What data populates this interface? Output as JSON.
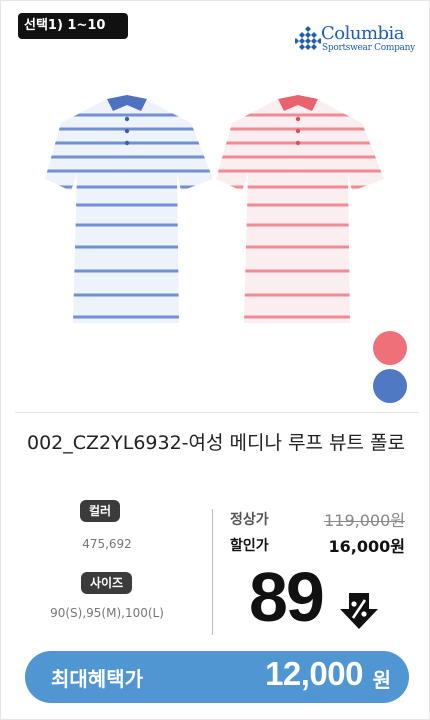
{
  "badge": {
    "select_label": "선택1) 1~10"
  },
  "brand": {
    "name": "Columbia",
    "subtitle": "Sportswear Company",
    "color": "#1d5fb3"
  },
  "product": {
    "title": "002_CZ2YL6932-여성 메디나 루프 뷰트 폴로",
    "image_icon": "striped-polo-shirts"
  },
  "swatches": [
    {
      "name": "pink",
      "hex": "#ef7078"
    },
    {
      "name": "blue",
      "hex": "#5079c4"
    }
  ],
  "options": {
    "color_label": "컬러",
    "color_values": "475,692",
    "size_label": "사이즈",
    "size_values": "90(S),95(M),100(L)"
  },
  "price": {
    "regular_label": "정상가",
    "regular_value": "119,000원",
    "sale_label": "할인가",
    "sale_value": "16,000원",
    "discount_number": "89",
    "discount_icon": "percent-down-arrow-icon"
  },
  "max_benefit": {
    "label": "최대혜택가",
    "amount": "12,000",
    "unit": "원",
    "bar_color": "#4f96d2"
  }
}
